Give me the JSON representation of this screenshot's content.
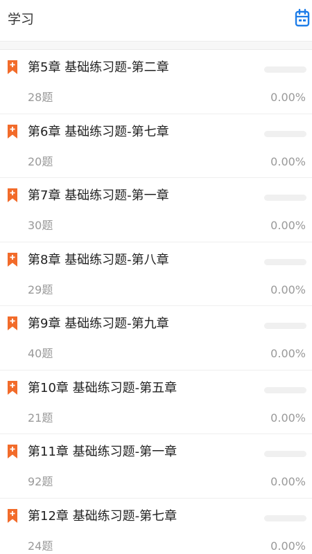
{
  "header": {
    "title": "学习",
    "calendar_icon": "calendar-icon",
    "accent_color": "#1e7de8"
  },
  "bookmark_icon": "bookmark-plus-icon",
  "bookmark_color": "#f26b2a",
  "items": [
    {
      "title": "第5章 基础练习题-第二章",
      "count": "28题",
      "percent": "0.00%",
      "progress": 0
    },
    {
      "title": "第6章 基础练习题-第七章",
      "count": "20题",
      "percent": "0.00%",
      "progress": 0
    },
    {
      "title": "第7章 基础练习题-第一章",
      "count": "30题",
      "percent": "0.00%",
      "progress": 0
    },
    {
      "title": "第8章 基础练习题-第八章",
      "count": "29题",
      "percent": "0.00%",
      "progress": 0
    },
    {
      "title": "第9章 基础练习题-第九章",
      "count": "40题",
      "percent": "0.00%",
      "progress": 0
    },
    {
      "title": "第10章 基础练习题-第五章",
      "count": "21题",
      "percent": "0.00%",
      "progress": 0
    },
    {
      "title": "第11章 基础练习题-第一章",
      "count": "92题",
      "percent": "0.00%",
      "progress": 0
    },
    {
      "title": "第12章 基础练习题-第七章",
      "count": "24题",
      "percent": "0.00%",
      "progress": 0
    }
  ]
}
